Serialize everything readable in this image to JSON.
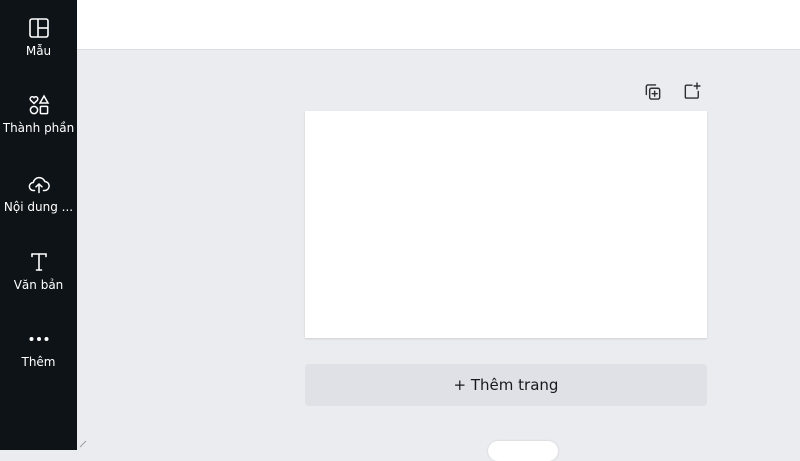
{
  "sidebar": {
    "items": [
      {
        "label": "Mẫu",
        "icon": "layout-template-icon"
      },
      {
        "label": "Thành phần",
        "icon": "shapes-icon"
      },
      {
        "label": "Nội dung ...",
        "icon": "cloud-upload-icon"
      },
      {
        "label": "Văn bản",
        "icon": "text-icon"
      },
      {
        "label": "Thêm",
        "icon": "more-dots-icon"
      }
    ]
  },
  "page_tools": {
    "duplicate_icon": "duplicate-page-icon",
    "add_icon": "add-page-icon"
  },
  "add_page": {
    "label": "+ Thêm trang"
  },
  "colors": {
    "sidebar_bg": "#0e1318",
    "workspace_bg": "#ebecf0",
    "button_bg": "#dfe1e6"
  }
}
